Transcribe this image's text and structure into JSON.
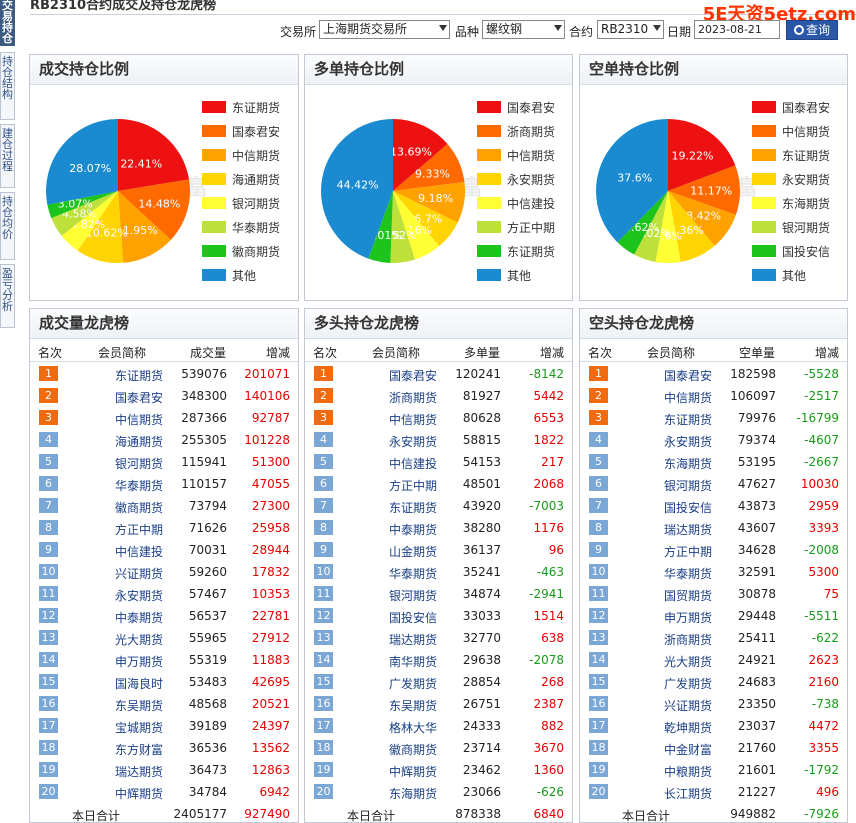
{
  "header": {
    "title": "RB2310合约成交及持仓龙虎榜",
    "logo": "5E天资5etz.com"
  },
  "side_tabs": [
    {
      "label": "交易持仓",
      "active": true
    },
    {
      "label": "持仓结构",
      "active": false
    },
    {
      "label": "建仓过程",
      "active": false
    },
    {
      "label": "持仓均价",
      "active": false
    },
    {
      "label": "盈亏分析",
      "active": false
    }
  ],
  "filters": {
    "exchange_label": "交易所",
    "exchange_value": "上海期货交易所",
    "variety_label": "品种",
    "variety_value": "螺纹钢",
    "contract_label": "合约",
    "contract_value": "RB2310",
    "date_label": "日期",
    "date_value": "2023-08-21",
    "query_label": "查询",
    "query_icon": "search-icon"
  },
  "colors": {
    "slice": [
      "#ee1111",
      "#ff6a00",
      "#ffa200",
      "#ffd400",
      "#ffff33",
      "#bde03a",
      "#1cc41c",
      "#1a8bd0"
    ],
    "rank_top": "#f06a0f",
    "rank_normal": "#7aa7d5",
    "positive": "#e60000",
    "negative": "#1a9a1a"
  },
  "chart_watermark": "东方财富",
  "chart_data": [
    {
      "type": "pie",
      "title": "成交持仓比例",
      "categories": [
        "东证期货",
        "国泰君安",
        "中信期货",
        "海通期货",
        "银河期货",
        "华泰期货",
        "徽商期货",
        "其他"
      ],
      "values": [
        22.41,
        14.48,
        11.95,
        10.62,
        4.82,
        4.58,
        3.07,
        28.07
      ],
      "labels": [
        "22.41%",
        "14.48%",
        "11.95%",
        "10.62%",
        "4.82%",
        "4.58%",
        "3.07%",
        "28.07%"
      ]
    },
    {
      "type": "pie",
      "title": "多单持仓比例",
      "categories": [
        "国泰君安",
        "浙商期货",
        "中信期货",
        "永安期货",
        "中信建投",
        "方正中期",
        "东证期货",
        "其他"
      ],
      "values": [
        13.69,
        9.33,
        9.18,
        6.7,
        6.16,
        5.52,
        5.01,
        44.42
      ],
      "labels": [
        "13.69%",
        "9.33%",
        "9.18%",
        "6.7%",
        "6.16%",
        "5.52%",
        "5.01%",
        "44.42%"
      ]
    },
    {
      "type": "pie",
      "title": "空单持仓比例",
      "categories": [
        "国泰君安",
        "中信期货",
        "东证期货",
        "永安期货",
        "东海期货",
        "银河期货",
        "国投安信",
        "其他"
      ],
      "values": [
        19.22,
        11.17,
        8.42,
        8.36,
        5.6,
        5.02,
        4.62,
        37.6
      ],
      "labels": [
        "19.22%",
        "11.17%",
        "8.42%",
        "8.36%",
        "5.6%",
        "5.02%",
        "4.62%",
        "37.6%"
      ]
    }
  ],
  "tables": [
    {
      "title": "成交量龙虎榜",
      "headers": [
        "名次",
        "会员简称",
        "成交量",
        "增减"
      ],
      "rows": [
        [
          "1",
          "东证期货",
          "539076",
          "201071"
        ],
        [
          "2",
          "国泰君安",
          "348300",
          "140106"
        ],
        [
          "3",
          "中信期货",
          "287366",
          "92787"
        ],
        [
          "4",
          "海通期货",
          "255305",
          "101228"
        ],
        [
          "5",
          "银河期货",
          "115941",
          "51300"
        ],
        [
          "6",
          "华泰期货",
          "110157",
          "47055"
        ],
        [
          "7",
          "徽商期货",
          "73794",
          "27300"
        ],
        [
          "8",
          "方正中期",
          "71626",
          "25958"
        ],
        [
          "9",
          "中信建投",
          "70031",
          "28944"
        ],
        [
          "10",
          "兴证期货",
          "59260",
          "17832"
        ],
        [
          "11",
          "永安期货",
          "57467",
          "10353"
        ],
        [
          "12",
          "中泰期货",
          "56537",
          "22781"
        ],
        [
          "13",
          "光大期货",
          "55965",
          "27912"
        ],
        [
          "14",
          "申万期货",
          "55319",
          "11883"
        ],
        [
          "15",
          "国海良时",
          "53483",
          "42695"
        ],
        [
          "16",
          "东吴期货",
          "48568",
          "20521"
        ],
        [
          "17",
          "宝城期货",
          "39189",
          "24397"
        ],
        [
          "18",
          "东方财富",
          "36536",
          "13562"
        ],
        [
          "19",
          "瑞达期货",
          "36473",
          "12863"
        ],
        [
          "20",
          "中辉期货",
          "34784",
          "6942"
        ]
      ],
      "total": [
        "本日合计",
        "2405177",
        "927490"
      ]
    },
    {
      "title": "多头持仓龙虎榜",
      "headers": [
        "名次",
        "会员简称",
        "多单量",
        "增减"
      ],
      "rows": [
        [
          "1",
          "国泰君安",
          "120241",
          "-8142"
        ],
        [
          "2",
          "浙商期货",
          "81927",
          "5442"
        ],
        [
          "3",
          "中信期货",
          "80628",
          "6553"
        ],
        [
          "4",
          "永安期货",
          "58815",
          "1822"
        ],
        [
          "5",
          "中信建投",
          "54153",
          "217"
        ],
        [
          "6",
          "方正中期",
          "48501",
          "2068"
        ],
        [
          "7",
          "东证期货",
          "43920",
          "-7003"
        ],
        [
          "8",
          "中泰期货",
          "38280",
          "1176"
        ],
        [
          "9",
          "山金期货",
          "36137",
          "96"
        ],
        [
          "10",
          "华泰期货",
          "35241",
          "-463"
        ],
        [
          "11",
          "银河期货",
          "34874",
          "-2941"
        ],
        [
          "12",
          "国投安信",
          "33033",
          "1514"
        ],
        [
          "13",
          "瑞达期货",
          "32770",
          "638"
        ],
        [
          "14",
          "南华期货",
          "29638",
          "-2078"
        ],
        [
          "15",
          "广发期货",
          "28854",
          "268"
        ],
        [
          "16",
          "东吴期货",
          "26751",
          "2387"
        ],
        [
          "17",
          "格林大华",
          "24333",
          "882"
        ],
        [
          "18",
          "徽商期货",
          "23714",
          "3670"
        ],
        [
          "19",
          "中辉期货",
          "23462",
          "1360"
        ],
        [
          "20",
          "东海期货",
          "23066",
          "-626"
        ]
      ],
      "total": [
        "本日合计",
        "878338",
        "6840"
      ]
    },
    {
      "title": "空头持仓龙虎榜",
      "headers": [
        "名次",
        "会员简称",
        "空单量",
        "增减"
      ],
      "rows": [
        [
          "1",
          "国泰君安",
          "182598",
          "-5528"
        ],
        [
          "2",
          "中信期货",
          "106097",
          "-2517"
        ],
        [
          "3",
          "东证期货",
          "79976",
          "-16799"
        ],
        [
          "4",
          "永安期货",
          "79374",
          "-4607"
        ],
        [
          "5",
          "东海期货",
          "53195",
          "-2667"
        ],
        [
          "6",
          "银河期货",
          "47627",
          "10030"
        ],
        [
          "7",
          "国投安信",
          "43873",
          "2959"
        ],
        [
          "8",
          "瑞达期货",
          "43607",
          "3393"
        ],
        [
          "9",
          "方正中期",
          "34628",
          "-2008"
        ],
        [
          "10",
          "华泰期货",
          "32591",
          "5300"
        ],
        [
          "11",
          "国贸期货",
          "30878",
          "75"
        ],
        [
          "12",
          "申万期货",
          "29448",
          "-5511"
        ],
        [
          "13",
          "浙商期货",
          "25411",
          "-622"
        ],
        [
          "14",
          "光大期货",
          "24921",
          "2623"
        ],
        [
          "15",
          "广发期货",
          "24683",
          "2160"
        ],
        [
          "16",
          "兴证期货",
          "23350",
          "-738"
        ],
        [
          "17",
          "乾坤期货",
          "23037",
          "4472"
        ],
        [
          "18",
          "中金财富",
          "21760",
          "3355"
        ],
        [
          "19",
          "中粮期货",
          "21601",
          "-1792"
        ],
        [
          "20",
          "长江期货",
          "21227",
          "496"
        ]
      ],
      "total": [
        "本日合计",
        "949882",
        "-7926"
      ]
    }
  ]
}
